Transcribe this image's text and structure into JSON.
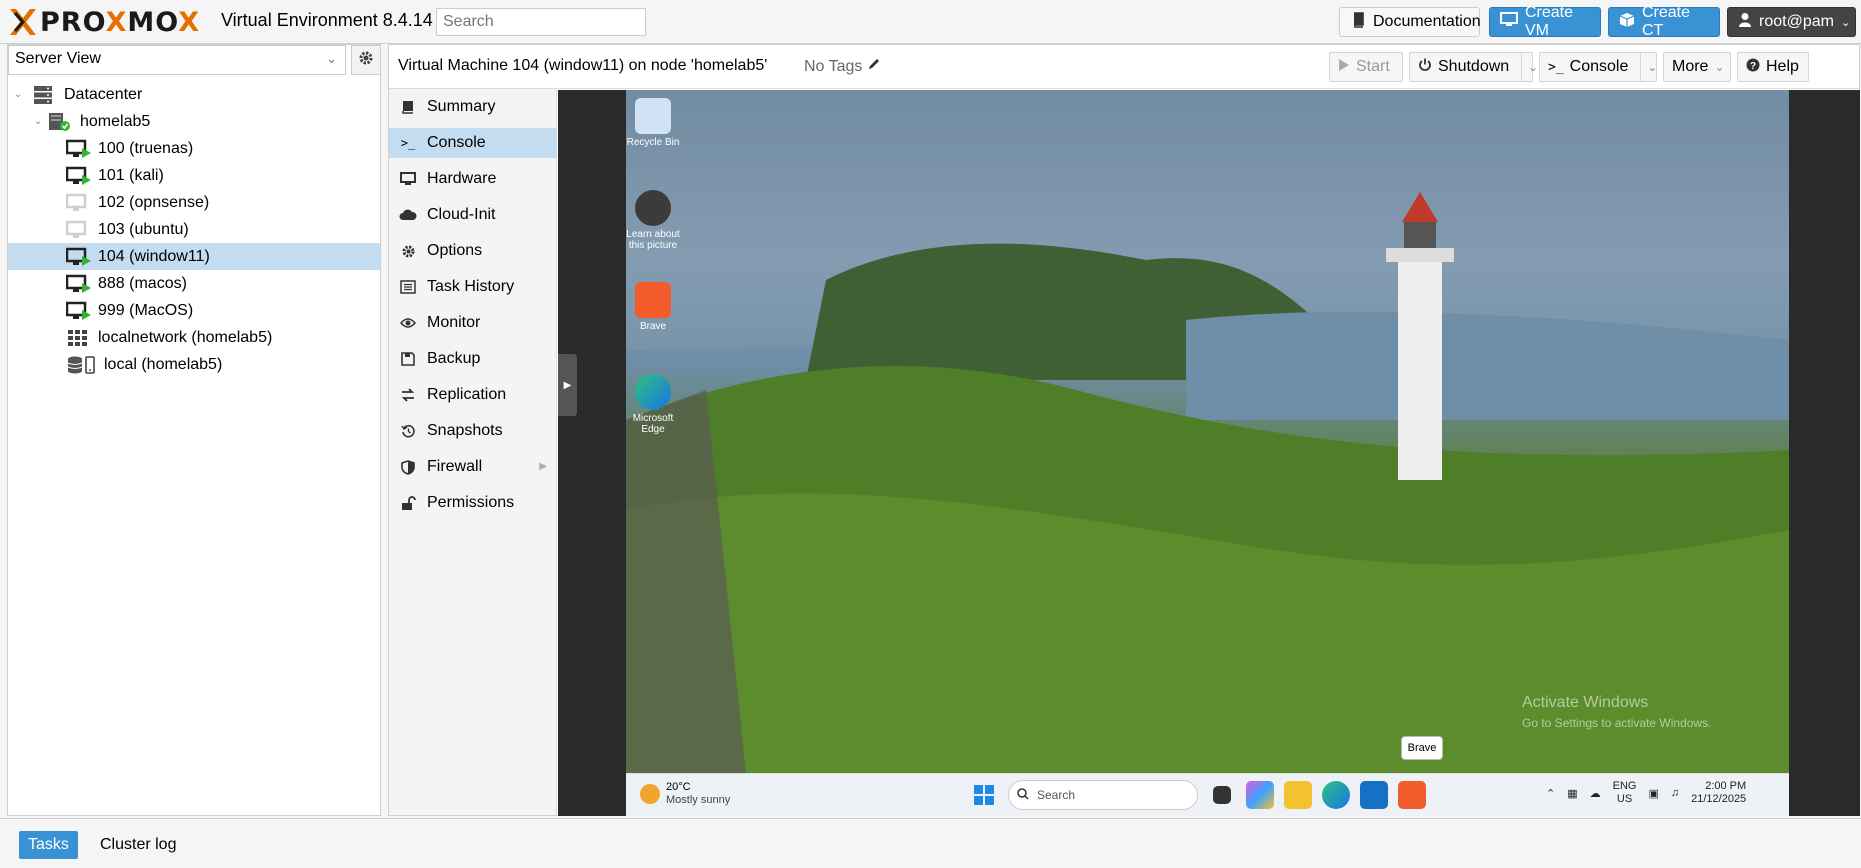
{
  "app": {
    "logo_text_a": "PRO",
    "logo_text_b": "X",
    "logo_text_c": "MO",
    "logo_text_d": "X",
    "version_label": "Virtual Environment 8.4.14",
    "search_placeholder": "Search"
  },
  "header_buttons": {
    "documentation": "Documentation",
    "create_vm": "Create VM",
    "create_ct": "Create CT",
    "user": "root@pam"
  },
  "left": {
    "view_select": "Server View",
    "tree": [
      {
        "label": "Datacenter",
        "icon": "datacenter-icon",
        "level": 0
      },
      {
        "label": "homelab5",
        "icon": "node-icon",
        "level": 1
      },
      {
        "label": "100 (truenas)",
        "icon": "vm-running-icon",
        "level": 2
      },
      {
        "label": "101 (kali)",
        "icon": "vm-running-icon",
        "level": 2
      },
      {
        "label": "102 (opnsense)",
        "icon": "vm-stopped-icon",
        "level": 2
      },
      {
        "label": "103 (ubuntu)",
        "icon": "vm-stopped-icon",
        "level": 2
      },
      {
        "label": "104 (window11)",
        "icon": "vm-running-icon",
        "level": 2,
        "selected": true
      },
      {
        "label": "888 (macos)",
        "icon": "vm-running-icon",
        "level": 2
      },
      {
        "label": "999 (MacOS)",
        "icon": "vm-running-icon",
        "level": 2
      },
      {
        "label": "localnetwork (homelab5)",
        "icon": "network-grid-icon",
        "level": 2
      },
      {
        "label": "local (homelab5)",
        "icon": "storage-icon",
        "level": 2
      }
    ]
  },
  "vm_header": {
    "title": "Virtual Machine 104 (window11) on node 'homelab5'",
    "tags": "No Tags",
    "start": "Start",
    "shutdown": "Shutdown",
    "console": "Console",
    "more": "More",
    "help": "Help"
  },
  "nav": [
    {
      "label": "Summary",
      "icon": "book-icon"
    },
    {
      "label": "Console",
      "icon": "terminal-icon",
      "selected": true
    },
    {
      "label": "Hardware",
      "icon": "monitor-icon"
    },
    {
      "label": "Cloud-Init",
      "icon": "cloud-icon"
    },
    {
      "label": "Options",
      "icon": "gear-icon"
    },
    {
      "label": "Task History",
      "icon": "list-icon"
    },
    {
      "label": "Monitor",
      "icon": "eye-icon"
    },
    {
      "label": "Backup",
      "icon": "floppy-icon"
    },
    {
      "label": "Replication",
      "icon": "replication-icon"
    },
    {
      "label": "Snapshots",
      "icon": "history-icon"
    },
    {
      "label": "Firewall",
      "icon": "shield-icon",
      "has_submenu": true
    },
    {
      "label": "Permissions",
      "icon": "unlock-icon"
    }
  ],
  "desktop": {
    "icons": [
      {
        "label": "Recycle Bin"
      },
      {
        "label": "Learn about this picture"
      },
      {
        "label": "Brave"
      },
      {
        "label": "Microsoft Edge"
      }
    ],
    "watermark_title": "Activate Windows",
    "watermark_sub": "Go to Settings to activate Windows.",
    "tooltip": "Brave"
  },
  "taskbar": {
    "temp": "20°C",
    "weather": "Mostly sunny",
    "search": "Search",
    "lang_top": "ENG",
    "lang_bottom": "US",
    "time": "2:00 PM",
    "date": "21/12/2025"
  },
  "bottom": {
    "tasks": "Tasks",
    "cluster_log": "Cluster log"
  },
  "colors": {
    "accent": "#3892d4",
    "selection": "#c3dcf0",
    "brand_orange": "#e57000",
    "running_green": "#2fb52f"
  }
}
